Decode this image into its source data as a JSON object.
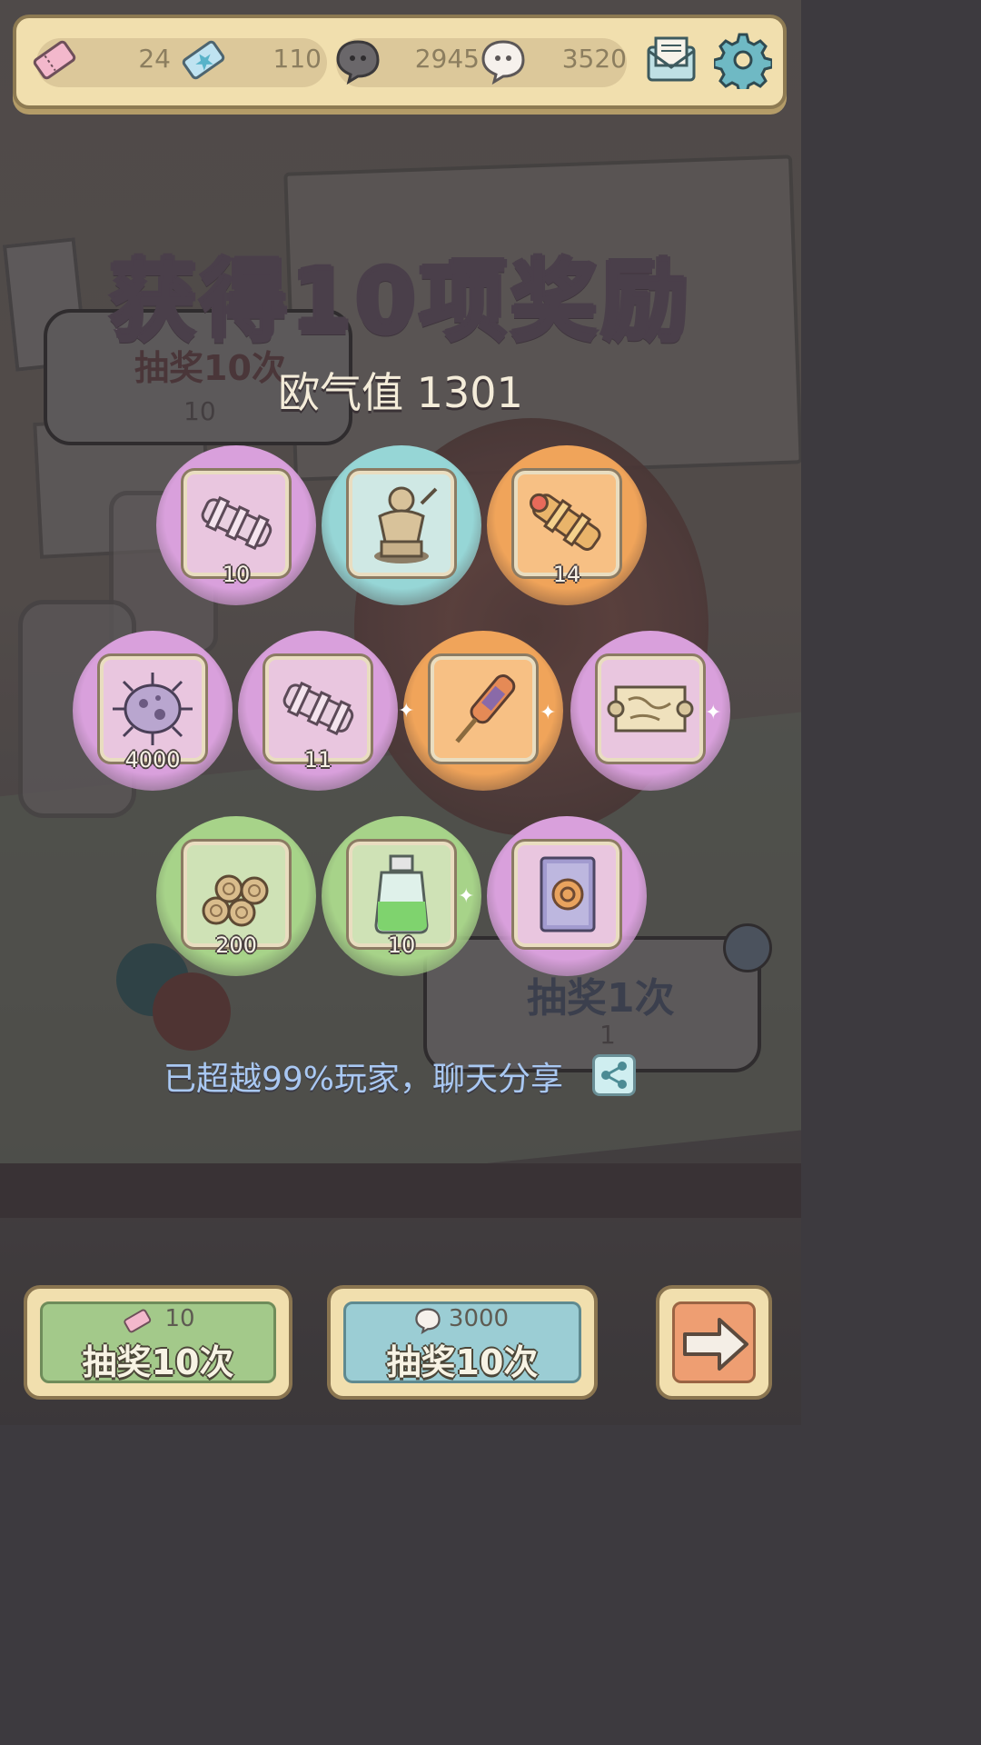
{
  "header": {
    "resources": [
      {
        "name": "pink-ticket",
        "value": "24"
      },
      {
        "name": "star-ticket",
        "value": "110"
      },
      {
        "name": "dark-speech-coin",
        "value": "2945"
      },
      {
        "name": "light-speech-coin",
        "value": "3520"
      }
    ],
    "mail_icon": "mail-icon",
    "settings_icon": "gear-icon"
  },
  "title": "获得10项奖励",
  "luck_label": "欧气值 1301",
  "background_panels": {
    "left_label": "抽奖10次",
    "left_cost": "10",
    "right_label": "抽奖1次",
    "right_cost": "1"
  },
  "rewards": [
    {
      "item": "pink-telescope",
      "rarity": "purple",
      "count": "10"
    },
    {
      "item": "statue",
      "rarity": "blue",
      "count": ""
    },
    {
      "item": "orange-telescope",
      "rarity": "orange",
      "count": "14"
    },
    {
      "item": "microbe",
      "rarity": "purple",
      "count": "4000"
    },
    {
      "item": "pink-telescope",
      "rarity": "purple",
      "count": "11"
    },
    {
      "item": "firework-stick",
      "rarity": "orange",
      "count": ""
    },
    {
      "item": "ancient-map",
      "rarity": "purple",
      "count": ""
    },
    {
      "item": "wood-logs",
      "rarity": "green",
      "count": "200"
    },
    {
      "item": "green-potion",
      "rarity": "green",
      "count": "10"
    },
    {
      "item": "magic-book",
      "rarity": "purple",
      "count": ""
    }
  ],
  "rarity_colors": {
    "purple": "#d9a0dc",
    "blue": "#96d6d6",
    "orange": "#f0a45a",
    "green": "#a7d389"
  },
  "share_text": "已超越99%玩家，聊天分享",
  "buttons": {
    "ticket_draw": {
      "cost": "10",
      "label": "抽奖10次"
    },
    "coin_draw": {
      "cost": "3000",
      "label": "抽奖10次"
    },
    "next": "arrow-right-icon"
  }
}
